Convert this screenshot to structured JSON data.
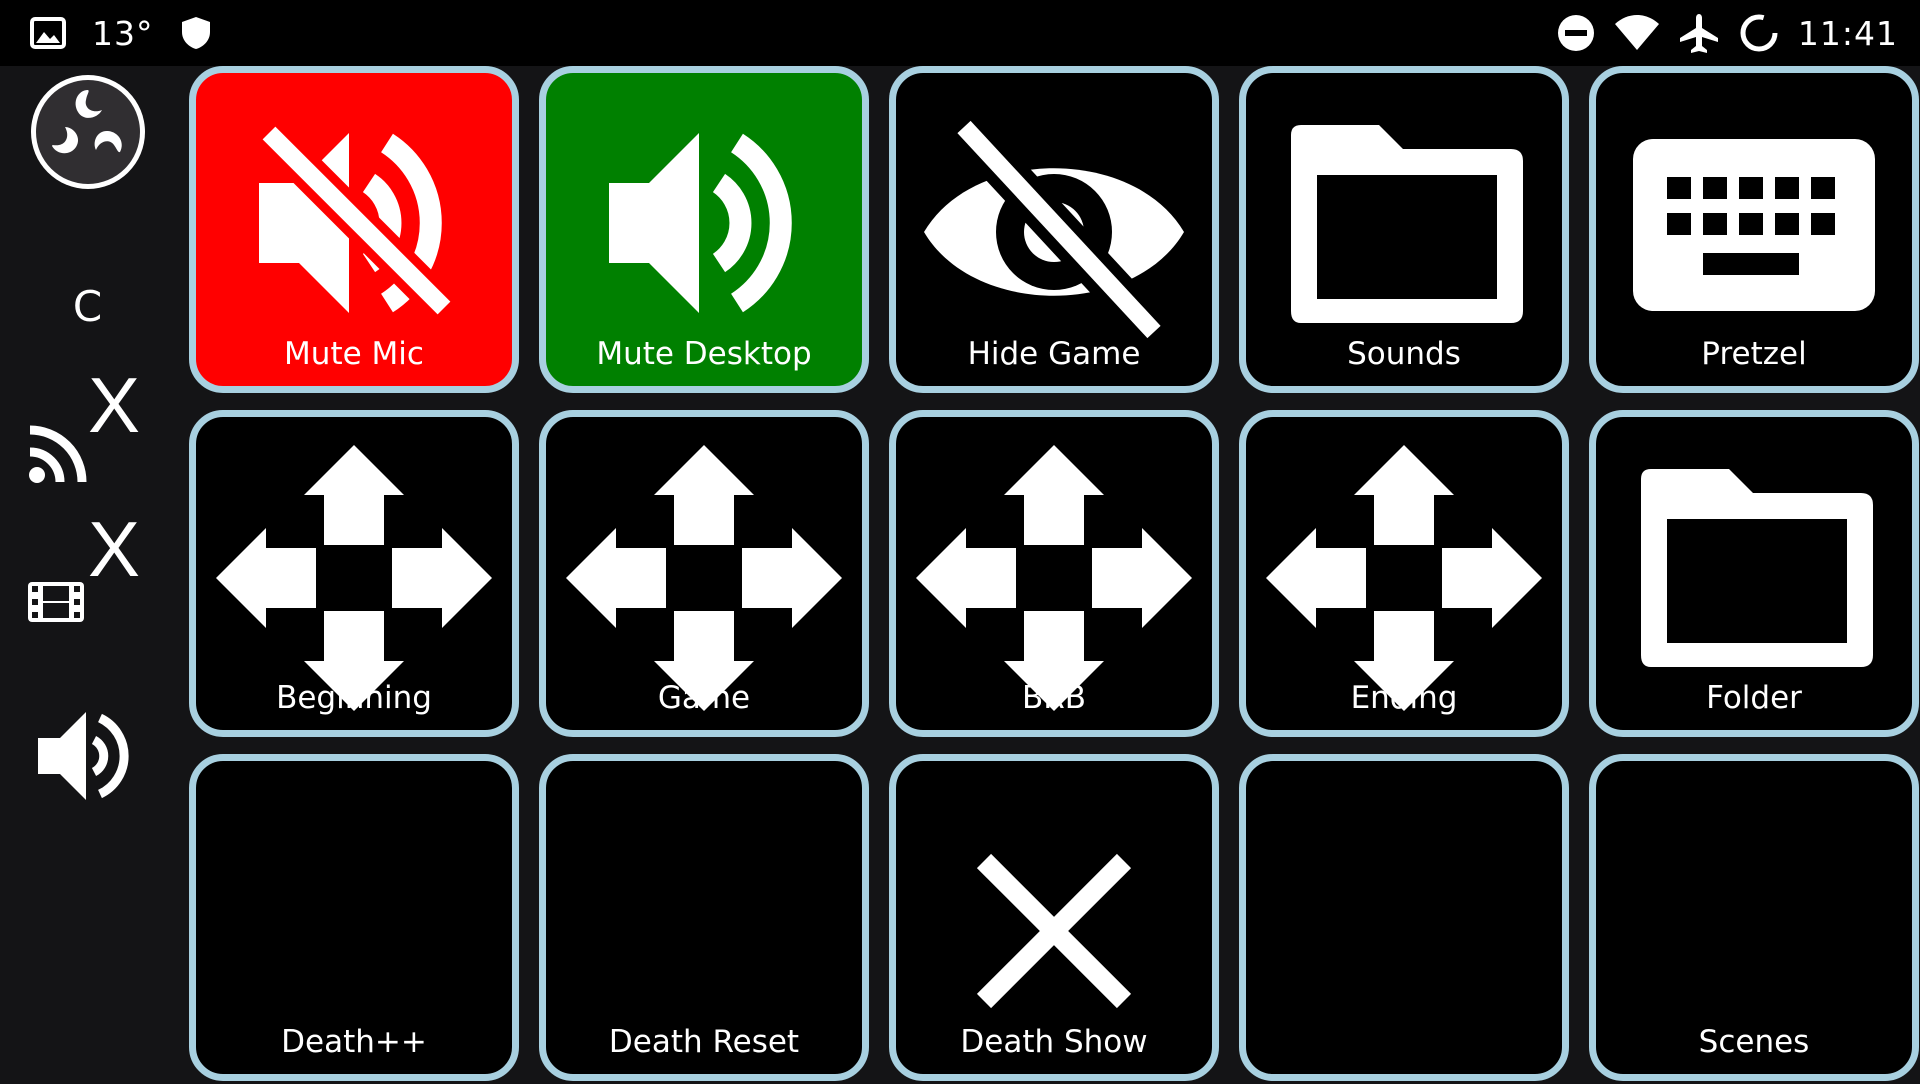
{
  "status_bar": {
    "temperature": "13°",
    "time": "11:41",
    "icons": [
      "image-icon",
      "shield-icon",
      "do-not-disturb-icon",
      "wifi-icon",
      "airplane-mode-icon",
      "sync-icon"
    ]
  },
  "sidebar": {
    "logo": "obs-logo-icon",
    "scene_letter": "C",
    "stream_status": "X",
    "record_status": "X",
    "icons": [
      "stream-icon",
      "record-icon",
      "volume-icon"
    ]
  },
  "colors": {
    "tile_border": "#a8d0e0",
    "tile_default": "#000000",
    "tile_red": "#ff0000",
    "tile_green": "#008000"
  },
  "tiles": [
    {
      "label": "Mute Mic",
      "icon": "speaker-muted-icon",
      "color": "red"
    },
    {
      "label": "Mute Desktop",
      "icon": "speaker-icon",
      "color": "green"
    },
    {
      "label": "Hide Game",
      "icon": "eye-off-icon",
      "color": "black"
    },
    {
      "label": "Sounds",
      "icon": "folder-icon",
      "color": "black"
    },
    {
      "label": "Pretzel",
      "icon": "keyboard-icon",
      "color": "black"
    },
    {
      "label": "Beginning",
      "icon": "move-arrows-icon",
      "color": "black"
    },
    {
      "label": "Game",
      "icon": "move-arrows-icon",
      "color": "black"
    },
    {
      "label": "BRB",
      "icon": "move-arrows-icon",
      "color": "black"
    },
    {
      "label": "Ending",
      "icon": "move-arrows-icon",
      "color": "black"
    },
    {
      "label": "Folder",
      "icon": "folder-icon",
      "color": "black"
    },
    {
      "label": "Death++",
      "icon": "",
      "color": "black"
    },
    {
      "label": "Death Reset",
      "icon": "",
      "color": "black"
    },
    {
      "label": "Death Show",
      "icon": "close-icon",
      "color": "black"
    },
    {
      "label": "",
      "icon": "",
      "color": "black"
    },
    {
      "label": "Scenes",
      "icon": "",
      "color": "black"
    }
  ]
}
